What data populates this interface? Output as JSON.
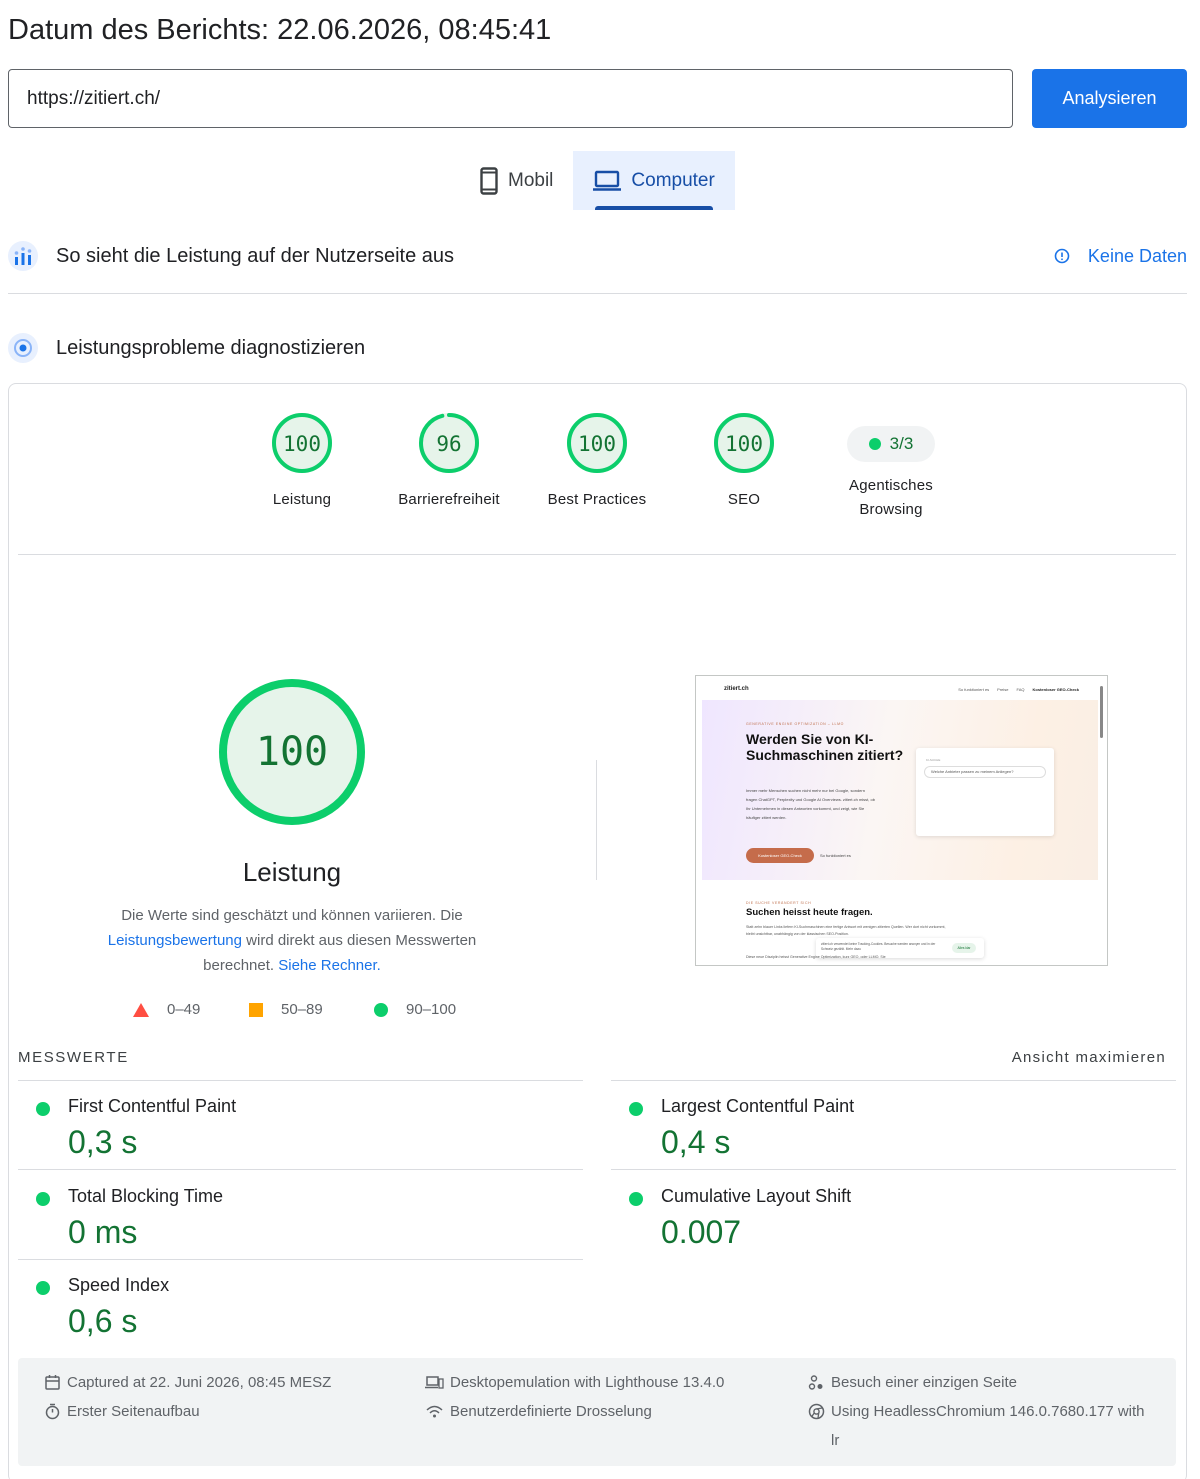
{
  "header": {
    "report_date": "Datum des Berichts: 22.06.2026, 08:45:41"
  },
  "search": {
    "url_value": "https://zitiert.ch/",
    "analyze_label": "Analysieren"
  },
  "device_tabs": [
    {
      "label": "Mobil",
      "icon": "smartphone-icon",
      "active": false
    },
    {
      "label": "Computer",
      "icon": "laptop-icon",
      "active": true
    }
  ],
  "field_section": {
    "title": "So sieht die Leistung auf der Nutzerseite aus",
    "status_label": "Keine Daten",
    "icon": "people-chart-icon"
  },
  "lab_section": {
    "title": "Leistungsprobleme diagnostizieren",
    "icon": "diagnostic-icon"
  },
  "scores": [
    {
      "value": "100",
      "label": "Leistung",
      "score": 100
    },
    {
      "value": "96",
      "label": "Barrierefreiheit",
      "score": 96
    },
    {
      "value": "100",
      "label": "Best Practices",
      "score": 100
    },
    {
      "value": "100",
      "label": "SEO",
      "score": 100
    }
  ],
  "agentic": {
    "value": "3/3",
    "label_line1": "Agentisches",
    "label_line2": "Browsing"
  },
  "performance": {
    "score": "100",
    "score_fraction": 1.0,
    "title": "Leistung",
    "desc_1": "Die Werte sind geschätzt und können variieren. Die",
    "desc_link_1": "Leistungsbewertung",
    "desc_2": " wird direkt aus diesen Messwerten",
    "desc_3": "berechnet. ",
    "desc_link_2": "Siehe Rechner."
  },
  "legend": {
    "poor": "0–49",
    "average": "50–89",
    "good": "90–100"
  },
  "screenshot": {
    "logo": "zitiert.ch",
    "nav_1": "So funktioniert es",
    "nav_2": "Preise",
    "nav_3": "FAQ",
    "nav_cta": "Kostenloser GEO-Check",
    "kicker": "GENERATIVE ENGINE OPTIMIZATION – LLMO",
    "headline": "Werden Sie von KI-Suchmaschinen zitiert?",
    "paragraph": "Immer mehr Menschen suchen nicht mehr nur bei Google, sondern fragen ChatGPT, Perplexity und Google AI Overviews. zitiert.ch misst, ob Ihr Unternehmen in diesen Antworten vorkommt, und zeigt, wie Sie häufiger zitiert werden.",
    "cta": "Kostenloser GEO-Check",
    "cta_link": "So funktioniert es",
    "box_label": "KI-SUCHE",
    "box_query": "Welche Anbieter passen zu meinem Anliegen?",
    "sec_kicker": "DIE SUCHE VERÄNDERT SICH",
    "sec_title": "Suchen heisst heute fragen.",
    "sec_text": "Statt zehn blauer Links liefern KI-Suchmaschinen eine fertige Antwort mit wenigen zitierten Quellen. Wer dort nicht vorkommt, bleibt unsichtbar, unabhängig von der klassischen SEO-Position.",
    "toast_text": "zitiert.ch verwendet keine Tracking-Cookies. Besuche werden anonym und in der Schweiz gezählt. Mehr dazu",
    "toast_btn": "Alles klar",
    "foot_text": "Diese neue Disziplin heisst Generative Engine Optimization, kurz GEO, oder LLMO. Sie"
  },
  "metrics": {
    "title": "MESSWERTE",
    "expand_label": "Ansicht maximieren",
    "items": [
      {
        "name": "First Contentful Paint",
        "value": "0,3 s"
      },
      {
        "name": "Largest Contentful Paint",
        "value": "0,4 s"
      },
      {
        "name": "Total Blocking Time",
        "value": "0 ms"
      },
      {
        "name": "Cumulative Layout Shift",
        "value": "0.007"
      },
      {
        "name": "Speed Index",
        "value": "0,6 s"
      }
    ]
  },
  "run_info": {
    "captured": "Captured at 22. Juni 2026, 08:45 MESZ",
    "load": "Erster Seitenaufbau",
    "emulation": "Desktopemulation with Lighthouse 13.4.0",
    "throttling": "Benutzerdefinierte Drosselung",
    "session": "Besuch einer einzigen Seite",
    "browser_1": "Using HeadlessChromium 146.0.7680.177 with",
    "browser_2": "lr"
  },
  "colors": {
    "accent": "#1a73e8",
    "good": "#0cce6b",
    "good_text": "#137333",
    "average": "#ffa400",
    "poor": "#ff4e42"
  }
}
